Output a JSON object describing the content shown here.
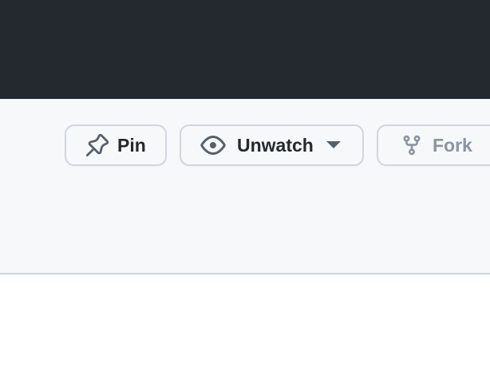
{
  "colors": {
    "topbar_bg": "#24292f",
    "header_bg": "#f6f8fa",
    "button_border": "#d0d7de",
    "text_primary": "#24292f",
    "text_disabled": "#8c959f",
    "icon": "#57606a"
  },
  "actions": {
    "pin_label": "Pin",
    "pin_icon": "pin-icon",
    "watch_label": "Unwatch",
    "watch_icon": "eye-icon",
    "watch_caret_icon": "triangle-down-icon",
    "fork_label": "Fork",
    "fork_icon": "repo-forked-icon"
  }
}
